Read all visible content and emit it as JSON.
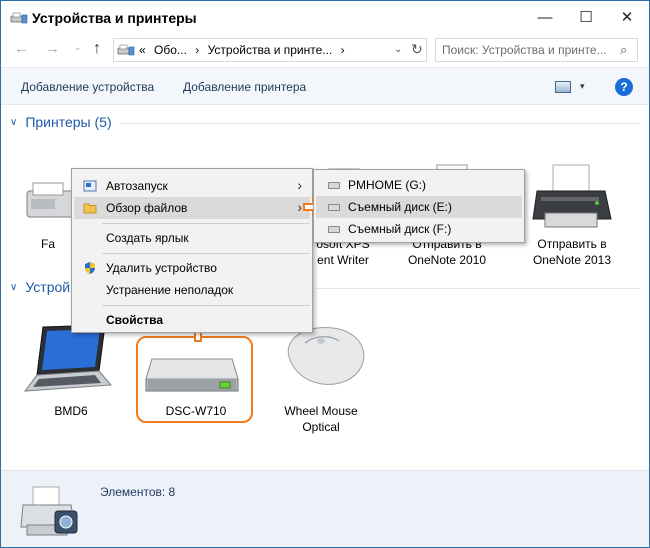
{
  "window": {
    "title": "Устройства и принтеры",
    "controls": {
      "minimize": "—",
      "maximize": "☐",
      "close": "✕"
    }
  },
  "nav": {
    "back": "←",
    "forward": "→",
    "recent": "⌄",
    "up": "↑",
    "breadcrumb": [
      "«",
      "Обо...",
      "›",
      "Устройства и принте...",
      "›"
    ],
    "dropdown": "⌄",
    "refresh": "↻",
    "search_placeholder": "Поиск: Устройства и принте...",
    "search_icon": "⌕"
  },
  "commands": {
    "add_device": "Добавление устройства",
    "add_printer": "Добавление принтера",
    "view_dropdown": "▾",
    "help": "?"
  },
  "groups": {
    "printers": {
      "chevron": "∨",
      "title": "Принтеры (5)"
    },
    "devices": {
      "chevron": "∨",
      "title": "Устрой"
    }
  },
  "printers": [
    {
      "name": "Fa",
      "line2": ""
    },
    {
      "name": "osoft XPS",
      "line2": "ent Writer"
    },
    {
      "name": "Отправить в",
      "line2": "OneNote 2010"
    },
    {
      "name": "Отправить в",
      "line2": "OneNote 2013"
    }
  ],
  "devices": [
    {
      "name": "BMD6",
      "line2": ""
    },
    {
      "name": "DSC-W710",
      "line2": ""
    },
    {
      "name": "Wheel Mouse",
      "line2": "Optical"
    }
  ],
  "context_menu": {
    "items": [
      {
        "label": "Автозапуск",
        "icon": "autoplay-icon",
        "submenu": "›"
      },
      {
        "label": "Обзор файлов",
        "icon": "folder-icon",
        "submenu": "›"
      },
      {
        "label": "Создать ярлык"
      },
      {
        "label": "Удалить устройство",
        "icon": "shield-icon"
      },
      {
        "label": "Устранение неполадок"
      },
      {
        "label": "Свойства"
      }
    ]
  },
  "submenu": {
    "items": [
      {
        "label": "PMHOME (G:)"
      },
      {
        "label": "Съемный диск (E:)"
      },
      {
        "label": "Съемный диск (F:)"
      }
    ]
  },
  "status": {
    "text": "Элементов: 8"
  },
  "colors": {
    "accent": "#1e5aa8",
    "annotation": "#f07d1e",
    "menu_bg": "#f2f2f2",
    "menu_highlight": "#dadada"
  }
}
